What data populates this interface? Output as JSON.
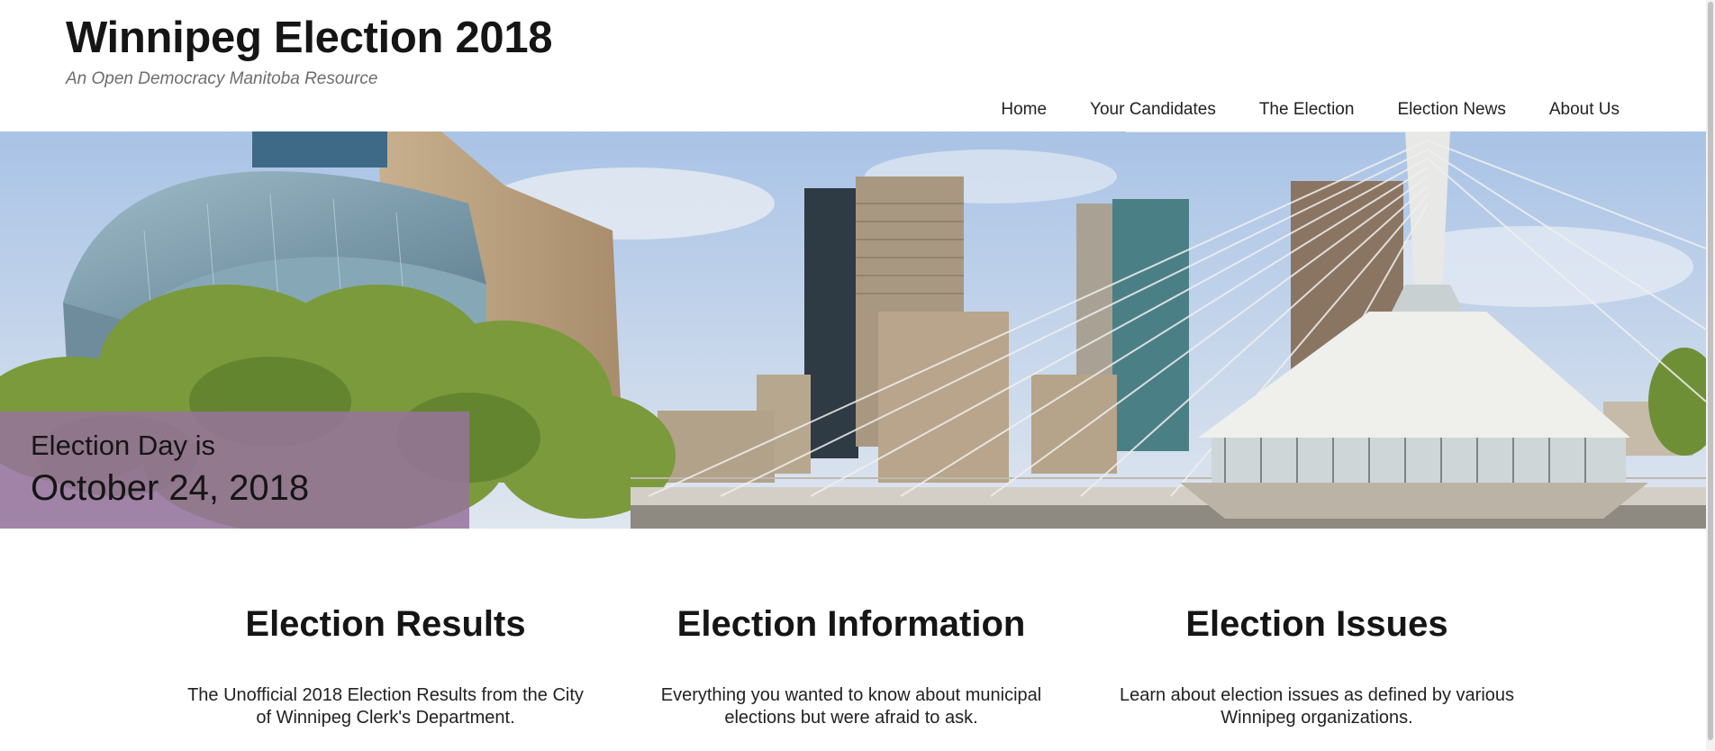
{
  "site": {
    "title": "Winnipeg Election 2018",
    "tagline": "An Open Democracy Manitoba Resource"
  },
  "nav": {
    "items": [
      {
        "label": "Home"
      },
      {
        "label": "Your Candidates"
      },
      {
        "label": "The Election"
      },
      {
        "label": "Election News"
      },
      {
        "label": "About Us"
      }
    ]
  },
  "hero": {
    "date_line1": "Election Day is",
    "date_line2": "October 24, 2018",
    "overlay_color": "#96739b"
  },
  "features": [
    {
      "heading": "Election Results",
      "text": "The Unofficial 2018 Election Results from the City of Winnipeg Clerk's Department."
    },
    {
      "heading": "Election Information",
      "text": "Everything you wanted to know about municipal elections but were afraid to ask."
    },
    {
      "heading": "Election Issues",
      "text": "Learn about election issues as defined by various Winnipeg organizations."
    }
  ]
}
